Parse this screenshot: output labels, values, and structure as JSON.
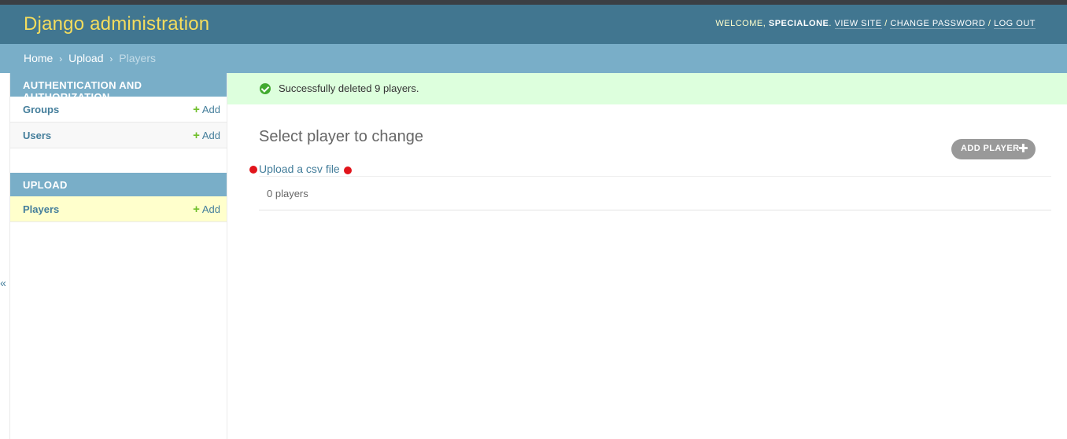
{
  "header": {
    "brand": "Django administration",
    "welcome": "WELCOME,",
    "username": "SPECIALONE",
    "view_site": "VIEW SITE",
    "change_password": "CHANGE PASSWORD",
    "log_out": "LOG OUT",
    "separator": "/"
  },
  "breadcrumbs": {
    "items": [
      "Home",
      "Upload",
      "Players"
    ],
    "separator": "›"
  },
  "sidebar": {
    "toggle_glyph": "«",
    "modules": [
      {
        "caption": "Authentication and Authorization",
        "rows": [
          {
            "name": "Groups",
            "add": "Add"
          },
          {
            "name": "Users",
            "add": "Add"
          }
        ]
      },
      {
        "caption": "Upload",
        "rows": [
          {
            "name": "Players",
            "add": "Add"
          }
        ]
      }
    ]
  },
  "message": {
    "text": "Successfully deleted 9 players.",
    "icon": "success-check-icon"
  },
  "content": {
    "title": "Select player to change",
    "add_button": "ADD PLAYER",
    "upload_link": "Upload a csv file",
    "result_count": "0 players"
  },
  "colors": {
    "header_bg": "#417690",
    "brand": "#f5dd5d",
    "breadcrumbs_bg": "#79aec8",
    "message_bg": "#ddffdd",
    "current_row_bg": "#ffffcc",
    "add_plus": "#70bf2b",
    "annotation_dot": "#e1141b"
  }
}
